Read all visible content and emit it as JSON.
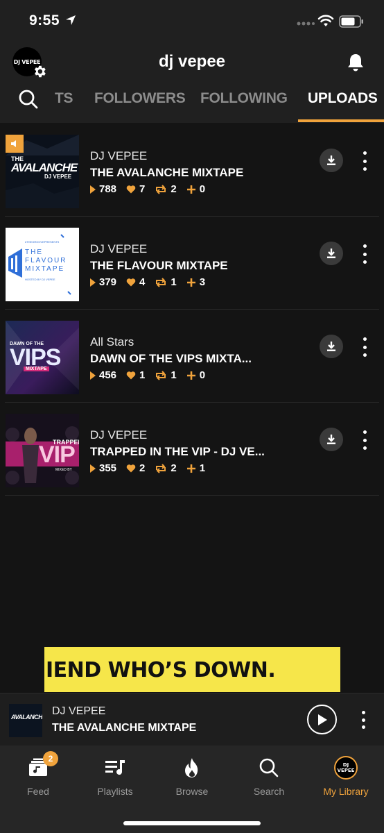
{
  "status": {
    "time": "9:55"
  },
  "header": {
    "title": "dj vepee",
    "avatar_text": "DJ VEPEE"
  },
  "tabs": [
    {
      "label": "TS"
    },
    {
      "label": "FOLLOWERS"
    },
    {
      "label": "FOLLOWING"
    },
    {
      "label": "UPLOADS"
    }
  ],
  "uploads": [
    {
      "artist": "DJ VEPEE",
      "title": "THE AVALANCHE MIXTAPE",
      "plays": "788",
      "likes": "7",
      "reposts": "2",
      "adds": "0",
      "cover": {
        "line1": "THE",
        "line2": "AVALANCHE",
        "line3": "DJ VEPEE"
      }
    },
    {
      "artist": "DJ VEPEE",
      "title": "THE FLAVOUR MIXTAPE",
      "plays": "379",
      "likes": "4",
      "reposts": "1",
      "adds": "3",
      "cover": {
        "tag": "#THEGROOVEPRESENTS",
        "line1": "THE",
        "line2": "FLAVOUR",
        "line3": "MIXTAPE",
        "line4": "HOSTED BY DJ VEPEE"
      }
    },
    {
      "artist": "All Stars",
      "title": "DAWN OF THE VIPS MIXTA...",
      "plays": "456",
      "likes": "1",
      "reposts": "1",
      "adds": "0",
      "cover": {
        "line1": "DAWN OF THE",
        "line2": "VIPS",
        "line3": "MIXTAPE"
      }
    },
    {
      "artist": "DJ VEPEE",
      "title": "TRAPPED IN THE VIP - DJ VE...",
      "plays": "355",
      "likes": "2",
      "reposts": "2",
      "adds": "1",
      "cover": {
        "line1": "TRAPPED",
        "line2": "VIP",
        "line3": "MIXED BY"
      }
    }
  ],
  "banner": {
    "text": "IEND WHO’S DOWN."
  },
  "mini_player": {
    "artist": "DJ VEPEE",
    "title": "THE AVALANCHE MIXTAPE",
    "thumb_text": "AVALANCHE"
  },
  "nav": [
    {
      "label": "Feed",
      "badge": "2"
    },
    {
      "label": "Playlists"
    },
    {
      "label": "Browse"
    },
    {
      "label": "Search"
    },
    {
      "label": "My Library",
      "avatar_text": "DJ VEPEE"
    }
  ],
  "colors": {
    "accent": "#f0a33c",
    "background": "#141414",
    "header": "#202020",
    "banner": "#f6e64a"
  }
}
